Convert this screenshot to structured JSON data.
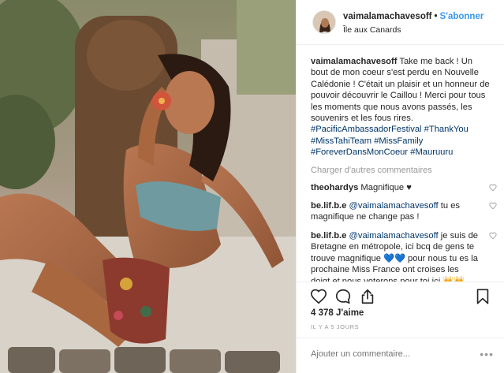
{
  "header": {
    "username": "vaimalamachavesoff",
    "separator": "•",
    "follow_label": "S'abonner",
    "location": "Île aux Canards"
  },
  "caption": {
    "username": "vaimalamachavesoff",
    "text": "Take me back ! Un bout de mon coeur s'est perdu en Nouvelle Calédonie ! C'était un plaisir et un honneur de pouvoir découvrir le Caillou ! Merci pour tous les moments que nous avons passés, les souvenirs et les fous rires.",
    "hashtags": [
      "#PacificAmbassadorFestival",
      "#ThankYou",
      "#MissTahiTeam",
      "#MissFamily",
      "#ForeverDansMonCoeur",
      "#Mauruuru"
    ]
  },
  "load_more_label": "Charger d'autres commentaires",
  "comments": [
    {
      "username": "theohardys",
      "mention": "",
      "text": "Magnifique ♥"
    },
    {
      "username": "be.lif.b.e",
      "mention": "@vaimalamachavesoff",
      "text": "tu es magnifique ne change pas !"
    },
    {
      "username": "be.lif.b.e",
      "mention": "@vaimalamachavesoff",
      "text": "je suis de Bretagne en métropole, ici bcq de gens te trouve magnifique 💙💙 pour nous tu es la prochaine Miss France ont croises les doigt et nous voterons pour toi ici 👑👑"
    }
  ],
  "actions": {
    "like_icon": "heart-icon",
    "comment_icon": "comment-bubble-icon",
    "share_icon": "share-icon",
    "save_icon": "bookmark-icon"
  },
  "likes_text": "4 378 J'aime",
  "timestamp": "IL Y A 5 JOURS",
  "add_comment": {
    "placeholder": "Ajouter un commentaire...",
    "more_label": "•••"
  },
  "colors": {
    "link": "#3897f0",
    "hashtag": "#003569",
    "muted": "#999999",
    "border": "#efefef",
    "swimsuit": "#6e9aa0"
  }
}
